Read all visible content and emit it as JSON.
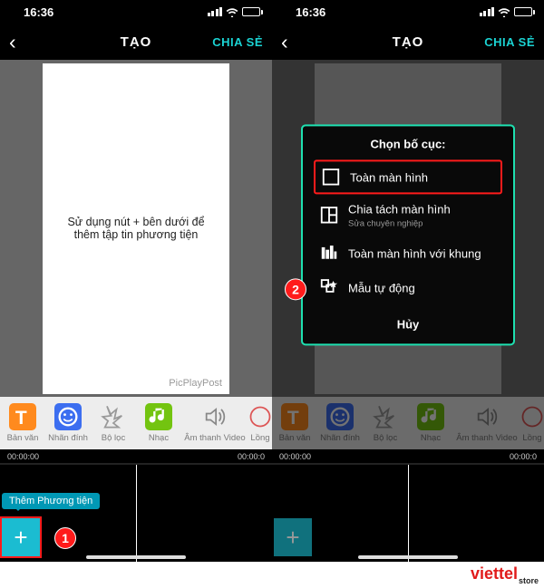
{
  "status": {
    "time": "16:36"
  },
  "nav": {
    "title": "TẠO",
    "share": "CHIA SẺ"
  },
  "canvas": {
    "hint": "Sử dụng nút + bên dưới để thêm tập tin phương tiện",
    "watermark": "PicPlayPost"
  },
  "popup": {
    "title": "Chọn bố cục:",
    "opts": [
      {
        "label": "Toàn màn hình",
        "sub": ""
      },
      {
        "label": "Chia tách màn hình",
        "sub": "Sửa chuyên nghiệp"
      },
      {
        "label": "Toàn màn hình với khung",
        "sub": ""
      },
      {
        "label": "Mẫu tự động",
        "sub": ""
      }
    ],
    "cancel": "Hủy"
  },
  "toolbar": {
    "items": [
      {
        "label": "Bản văn"
      },
      {
        "label": "Nhãn đính"
      },
      {
        "label": "Bộ lọc"
      },
      {
        "label": "Nhạc"
      },
      {
        "label": "Âm thanh Video"
      },
      {
        "label": "Lồng"
      }
    ]
  },
  "timeline": {
    "start": "00:00:00",
    "end": "00:00:0"
  },
  "tooltip": "Thêm Phương tiện",
  "markers": {
    "one": "1",
    "two": "2"
  },
  "brand": {
    "name": "viettel",
    "sub": "store"
  }
}
